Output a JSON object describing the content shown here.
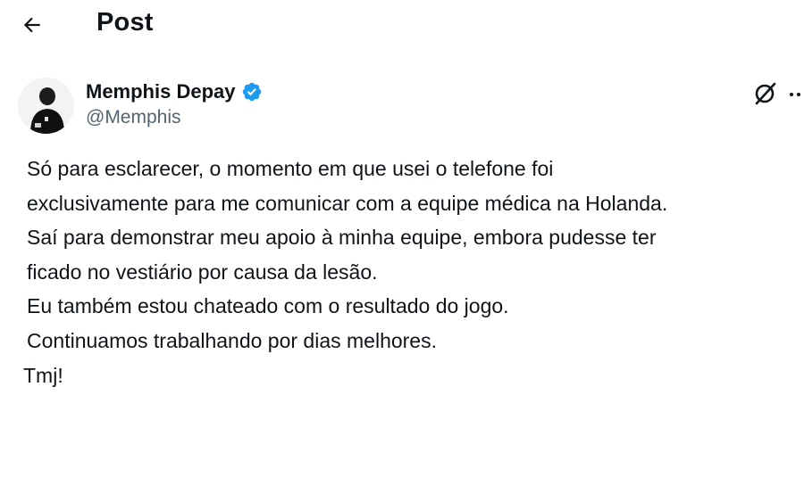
{
  "header": {
    "back_icon": "arrow-left-icon",
    "title": "Post"
  },
  "author": {
    "display_name": "Memphis Depay",
    "handle": "@Memphis",
    "verified_icon": "verified-badge-icon",
    "verified_color": "#1d9bf0"
  },
  "actions": {
    "grok_icon": "grok-icon",
    "more_icon": "more-horizontal-icon"
  },
  "tweet": {
    "lines": [
      "Só para esclarecer, o momento em que usei o telefone foi",
      "exclusivamente para me comunicar com a equipe médica na Holanda.",
      "Saí para demonstrar meu apoio à minha equipe, embora pudesse ter",
      "ficado no vestiário por causa da lesão.",
      "Eu também estou chateado com o resultado do jogo.",
      "Continuamos trabalhando por dias melhores."
    ],
    "signoff": "Tmj!"
  },
  "colors": {
    "text": "#0f1419",
    "secondary_text": "#536471",
    "background": "#ffffff"
  }
}
